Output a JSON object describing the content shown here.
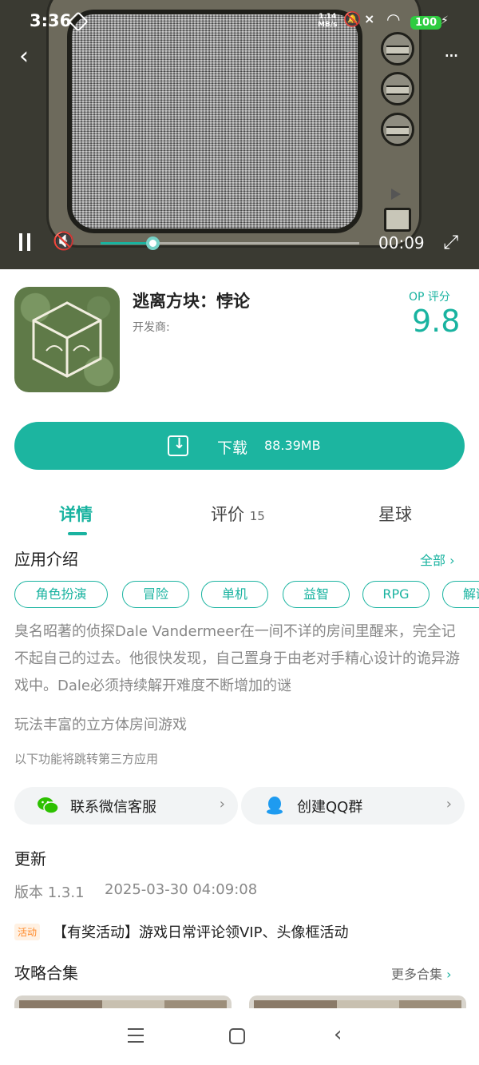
{
  "status_bar": {
    "time": "3:36",
    "network_speed": "1.14",
    "network_unit": "MB/s",
    "battery": "100"
  },
  "video": {
    "current_time": "00:09",
    "progress": 0.2
  },
  "app": {
    "name": "逃离方块：悖论",
    "developer_label": "开发商:",
    "score_label": "OP 评分",
    "score": "9.8",
    "accent_color": "#19b3a0"
  },
  "download": {
    "label": "下载",
    "size": "88.39MB"
  },
  "tabs": [
    {
      "label": "详情",
      "count": ""
    },
    {
      "label": "评价",
      "count": "15"
    },
    {
      "label": "星球",
      "count": ""
    }
  ],
  "intro": {
    "title": "应用介绍",
    "all_link": "全部",
    "tags": [
      "角色扮演",
      "冒险",
      "单机",
      "益智",
      "RPG",
      "解谜"
    ],
    "description": "臭名昭著的侦探Dale Vandermeer在一间不详的房间里醒来，完全记不起自己的过去。他很快发现，自己置身于由老对手精心设计的诡异游戏中。Dale必须持续解开难度不断增加的谜",
    "summary": "玩法丰富的立方体房间游戏",
    "third_party_note": "以下功能将跳转第三方应用"
  },
  "contacts": [
    {
      "label": "联系微信客服",
      "icon": "wechat-icon"
    },
    {
      "label": "创建QQ群",
      "icon": "qq-icon"
    }
  ],
  "update": {
    "title": "更新",
    "version": "版本 1.3.1",
    "date": "2025-03-30 04:09:08"
  },
  "activity": {
    "badge": "活动",
    "text": "【有奖活动】游戏日常评论领VIP、头像框活动"
  },
  "guides": {
    "title": "攻略合集",
    "more_link": "更多合集"
  }
}
